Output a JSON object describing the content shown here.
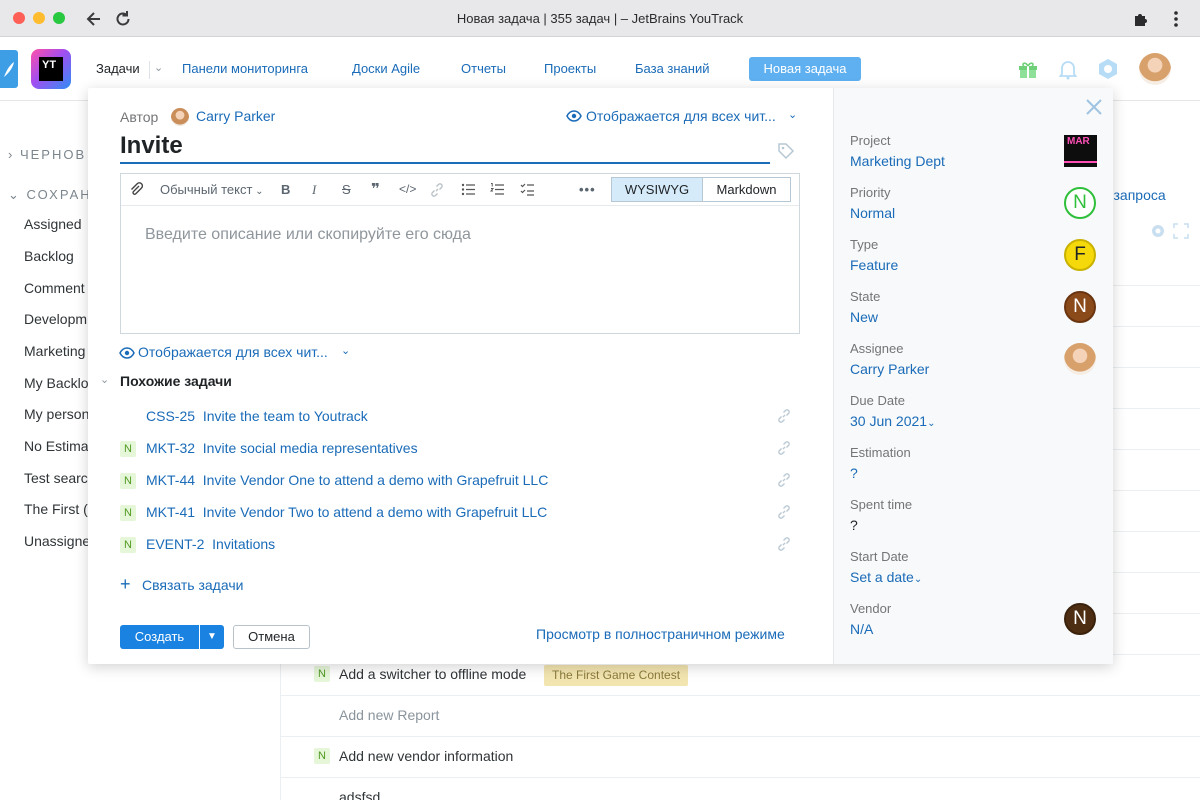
{
  "window": {
    "title": "Новая задача | 355 задач | – JetBrains YouTrack"
  },
  "header": {
    "logo_text": "YT",
    "nav": [
      "Задачи",
      "Панели мониторинга",
      "Доски Agile",
      "Отчеты",
      "Проекты",
      "База знаний"
    ],
    "new_issue": "Новая задача"
  },
  "background": {
    "sections": [
      "ЧЕРНОВ",
      "СОХРАН"
    ],
    "items": [
      "Assigned",
      "Backlog",
      "Comment",
      "Developm",
      "Marketing",
      "My Backlo",
      "My person",
      "No Estima",
      "Test searc",
      "The First (",
      "Unassigne"
    ],
    "rows": [
      {
        "badge": "N",
        "text": "Add a switcher to offline mode",
        "tag": "The First Game Contest"
      },
      {
        "badge": "",
        "text": "Add new Report"
      },
      {
        "badge": "N",
        "text": "Add new vendor information"
      },
      {
        "badge": "",
        "text": "adsfsd"
      }
    ],
    "query_link": "м запроса"
  },
  "modal": {
    "author_label": "Автор",
    "author_name": "Carry Parker",
    "visibility": "Отображается для всех чит...",
    "summary": "Invite",
    "toolbar": {
      "text_style": "Обычный текст",
      "wysiwyg": "WYSIWYG",
      "markdown": "Markdown"
    },
    "placeholder": "Введите описание или скопируйте его сюда",
    "visibility_bottom": "Отображается для всех чит...",
    "similar_title": "Похожие задачи",
    "similar": [
      {
        "badge": "",
        "id": "CSS-25",
        "title": "Invite the team to Youtrack"
      },
      {
        "badge": "N",
        "id": "MKT-32",
        "title": "Invite social media representatives"
      },
      {
        "badge": "N",
        "id": "MKT-44",
        "title": "Invite Vendor One to attend a demo with Grapefruit LLC"
      },
      {
        "badge": "N",
        "id": "MKT-41",
        "title": "Invite Vendor Two to attend a demo with Grapefruit LLC"
      },
      {
        "badge": "N",
        "id": "EVENT-2",
        "title": "Invitations"
      }
    ],
    "link_issues": "Связать задачи",
    "create": "Создать",
    "cancel": "Отмена",
    "fullscreen": "Просмотр в полностраничном режиме"
  },
  "fields": [
    {
      "label": "Project",
      "value": "Marketing Dept",
      "badge": "MAR"
    },
    {
      "label": "Priority",
      "value": "Normal",
      "badge": "N",
      "color": "#2fbf3a"
    },
    {
      "label": "Type",
      "value": "Feature",
      "badge": "F",
      "color": "#f5d90a"
    },
    {
      "label": "State",
      "value": "New",
      "badge": "N",
      "color": "#8b4a1a"
    },
    {
      "label": "Assignee",
      "value": "Carry Parker"
    },
    {
      "label": "Due Date",
      "value": "30 Jun 2021"
    },
    {
      "label": "Estimation",
      "value": "?"
    },
    {
      "label": "Spent time",
      "value": "?"
    },
    {
      "label": "Start Date",
      "value": "Set a date"
    },
    {
      "label": "Vendor",
      "value": "N/A",
      "badge": "N",
      "color": "#4e2e12"
    }
  ]
}
